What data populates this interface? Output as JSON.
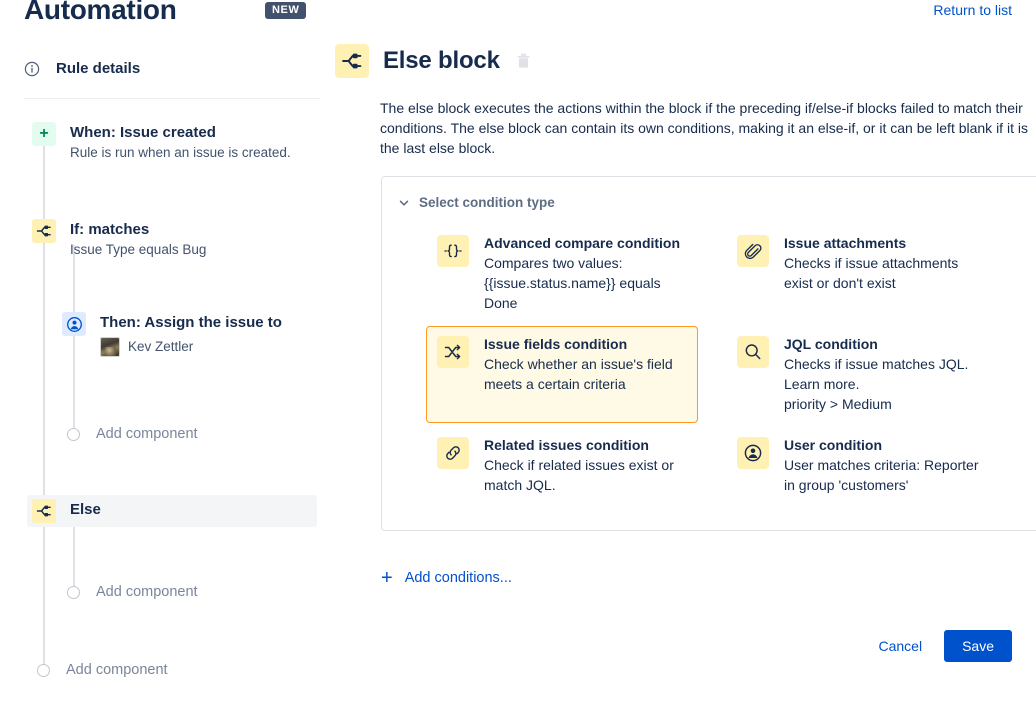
{
  "header": {
    "title": "Automation",
    "badge": "NEW",
    "return_link": "Return to list"
  },
  "sidebar": {
    "rule_details": {
      "label": "Rule details",
      "icon": "info-icon"
    },
    "nodes": [
      {
        "icon": "plus-icon",
        "title": "When: Issue created",
        "subtitle": "Rule is run when an issue is created."
      },
      {
        "icon": "branch-icon",
        "title": "If: matches",
        "subtitle": "Issue Type equals Bug"
      },
      {
        "icon": "user-icon",
        "title": "Then: Assign the issue to",
        "assignee": "Kev Zettler"
      },
      {
        "icon": "branch-icon",
        "title": "Else",
        "subtitle": ""
      }
    ],
    "add_component_labels": [
      "Add component",
      "Add component",
      "Add component"
    ]
  },
  "main": {
    "block_icon": "branch-icon",
    "block_title": "Else block",
    "delete_icon": "trash-icon",
    "description": "The else block executes the actions within the block if the preceding if/else-if blocks failed to match their conditions. The else block can contain its own conditions, making it an else-if, or it can be left blank if it is the last else block.",
    "panel": {
      "header_label": "Select condition type",
      "header_icon": "chevron-down-icon",
      "conditions": [
        {
          "icon": "curly-braces-icon",
          "name": "Advanced compare condition",
          "desc": "Compares two values: {{issue.status.name}} equals Done",
          "selected": false
        },
        {
          "icon": "paperclip-icon",
          "name": "Issue attachments",
          "desc": "Checks if issue attachments exist or don't exist",
          "selected": false
        },
        {
          "icon": "shuffle-icon",
          "name": "Issue fields condition",
          "desc": "Check whether an issue's field meets a certain criteria",
          "selected": true
        },
        {
          "icon": "search-icon",
          "name": "JQL condition",
          "desc": "Checks if issue matches JQL. Learn more.\npriority > Medium",
          "selected": false
        },
        {
          "icon": "link-icon",
          "name": "Related issues condition",
          "desc": "Check if related issues exist or match JQL.",
          "selected": false
        },
        {
          "icon": "user-circle-icon",
          "name": "User condition",
          "desc": "User matches criteria: Reporter in group 'customers'",
          "selected": false
        }
      ]
    },
    "add_conditions_label": "Add conditions...",
    "cancel_label": "Cancel",
    "save_label": "Save"
  },
  "colors": {
    "accent_blue": "#0052CC",
    "text_primary": "#172B4D",
    "text_muted": "#7A869A",
    "icon_tile_yellow": "#FFF0B3",
    "selected_bg": "#FFFAE6",
    "selected_border": "#FF991F",
    "badge_bg": "#42526E"
  }
}
